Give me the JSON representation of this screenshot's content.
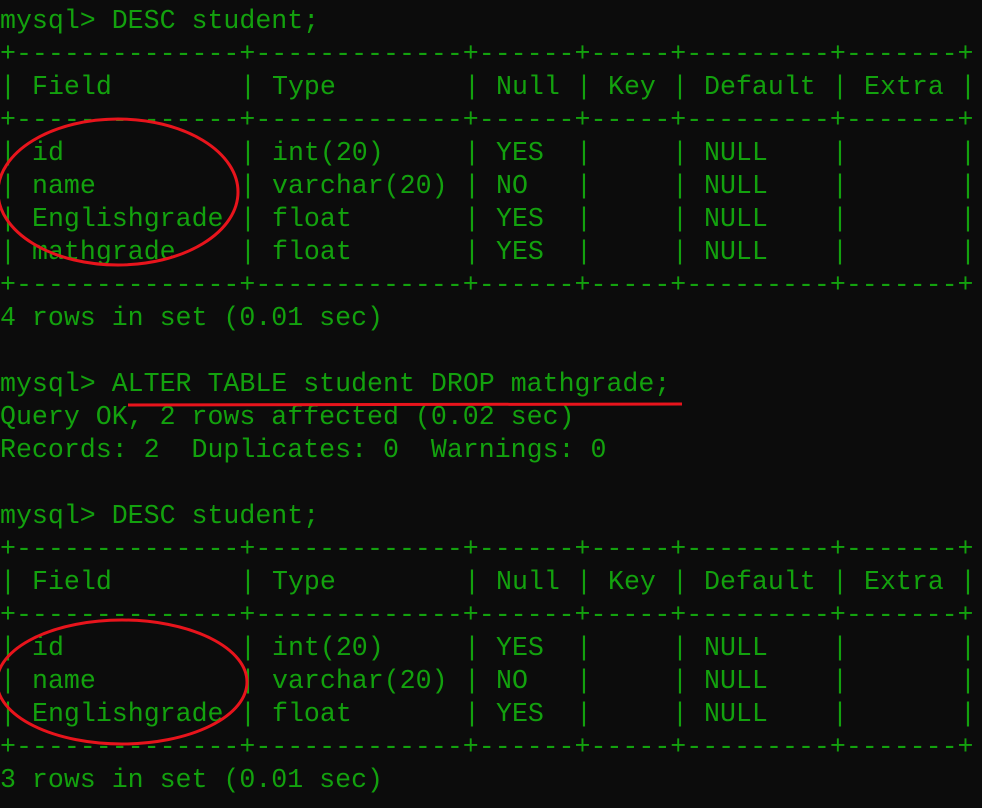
{
  "terminal": {
    "foreground": "#13a10e",
    "background": "#0c0c0c",
    "annotation_color": "#e8141c",
    "blocks": [
      {
        "kind": "prompt",
        "prompt": "mysql> ",
        "command": "DESC student;"
      },
      {
        "kind": "table",
        "headers": [
          "Field",
          "Type",
          "Null",
          "Key",
          "Default",
          "Extra"
        ],
        "rows": [
          [
            "id",
            "int(20)",
            "YES",
            "",
            "NULL",
            ""
          ],
          [
            "name",
            "varchar(20)",
            "NO",
            "",
            "NULL",
            ""
          ],
          [
            "Englishgrade",
            "float",
            "YES",
            "",
            "NULL",
            ""
          ],
          [
            "mathgrade",
            "float",
            "YES",
            "",
            "NULL",
            ""
          ]
        ]
      },
      {
        "kind": "text",
        "text": "4 rows in set (0.01 sec)"
      },
      {
        "kind": "blank"
      },
      {
        "kind": "prompt",
        "prompt": "mysql> ",
        "command": "ALTER TABLE student DROP mathgrade;"
      },
      {
        "kind": "text",
        "text": "Query OK, 2 rows affected (0.02 sec)"
      },
      {
        "kind": "text",
        "text": "Records: 2  Duplicates: 0  Warnings: 0"
      },
      {
        "kind": "blank"
      },
      {
        "kind": "prompt",
        "prompt": "mysql> ",
        "command": "DESC student;"
      },
      {
        "kind": "table",
        "headers": [
          "Field",
          "Type",
          "Null",
          "Key",
          "Default",
          "Extra"
        ],
        "rows": [
          [
            "id",
            "int(20)",
            "YES",
            "",
            "NULL",
            ""
          ],
          [
            "name",
            "varchar(20)",
            "NO",
            "",
            "NULL",
            ""
          ],
          [
            "Englishgrade",
            "float",
            "YES",
            "",
            "NULL",
            ""
          ]
        ]
      },
      {
        "kind": "text",
        "text": "3 rows in set (0.01 sec)"
      }
    ]
  }
}
